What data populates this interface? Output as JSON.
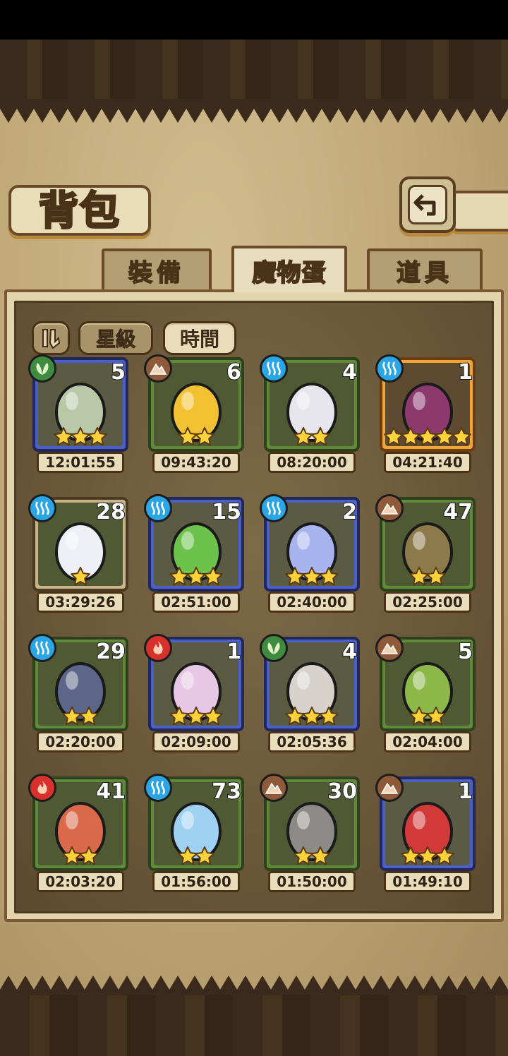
{
  "title": "背包",
  "tabs": [
    {
      "label": "裝備",
      "active": false
    },
    {
      "label": "魔物蛋",
      "active": true
    },
    {
      "label": "道具",
      "active": false
    }
  ],
  "sort": {
    "star_label": "星級",
    "time_label": "時間",
    "active": "時間"
  },
  "colors": {
    "water": "#2aa6e6",
    "earth": "#8e5a3a",
    "grass": "#3f8b3f",
    "fire": "#d8302a"
  },
  "eggs": [
    {
      "element": "grass",
      "count": "5",
      "stars": 3,
      "timer": "12:01:55",
      "frame": "blue",
      "color": "#b9c9a8"
    },
    {
      "element": "earth",
      "count": "6",
      "stars": 2,
      "timer": "09:43:20",
      "frame": "green",
      "color": "#f2c233"
    },
    {
      "element": "water",
      "count": "4",
      "stars": 2,
      "timer": "08:20:00",
      "frame": "green",
      "color": "#e6e6ec"
    },
    {
      "element": "water",
      "count": "1",
      "stars": 5,
      "timer": "04:21:40",
      "frame": "orange",
      "color": "#8c3a6e"
    },
    {
      "element": "water",
      "count": "28",
      "stars": 1,
      "timer": "03:29:26",
      "frame": "tan",
      "color": "#eef0f6"
    },
    {
      "element": "water",
      "count": "15",
      "stars": 3,
      "timer": "02:51:00",
      "frame": "blue",
      "color": "#6cc24a"
    },
    {
      "element": "water",
      "count": "2",
      "stars": 3,
      "timer": "02:40:00",
      "frame": "blue",
      "color": "#a8b4ee"
    },
    {
      "element": "earth",
      "count": "47",
      "stars": 2,
      "timer": "02:25:00",
      "frame": "green",
      "color": "#8c7a4a"
    },
    {
      "element": "water",
      "count": "29",
      "stars": 2,
      "timer": "02:20:00",
      "frame": "green",
      "color": "#5c6688"
    },
    {
      "element": "fire",
      "count": "1",
      "stars": 3,
      "timer": "02:09:00",
      "frame": "blue",
      "color": "#e8c6e6"
    },
    {
      "element": "grass",
      "count": "4",
      "stars": 3,
      "timer": "02:05:36",
      "frame": "blue",
      "color": "#d8d2cc"
    },
    {
      "element": "earth",
      "count": "5",
      "stars": 2,
      "timer": "02:04:00",
      "frame": "green",
      "color": "#8cb84a"
    },
    {
      "element": "fire",
      "count": "41",
      "stars": 2,
      "timer": "02:03:20",
      "frame": "green",
      "color": "#d9694a"
    },
    {
      "element": "water",
      "count": "73",
      "stars": 2,
      "timer": "01:56:00",
      "frame": "green",
      "color": "#9fd2f2"
    },
    {
      "element": "earth",
      "count": "30",
      "stars": 2,
      "timer": "01:50:00",
      "frame": "green",
      "color": "#8c8a86"
    },
    {
      "element": "earth",
      "count": "1",
      "stars": 3,
      "timer": "01:49:10",
      "frame": "blue",
      "color": "#d23a3a"
    }
  ]
}
